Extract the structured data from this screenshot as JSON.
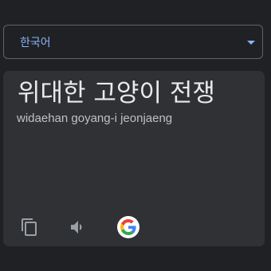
{
  "language_selector": {
    "selected": "한국어"
  },
  "result": {
    "translation": "위대한 고양이 전쟁",
    "romanization": "widaehan goyang-i jeonjaeng"
  },
  "actions": {
    "copy_icon": "copy-icon",
    "speak_icon": "speaker-icon",
    "google_icon": "google-logo-icon"
  },
  "colors": {
    "background": "#202124",
    "card": "#303134",
    "accent": "#8ab4f8",
    "text_primary": "#e8eaed",
    "text_secondary": "#bdc1c6",
    "icon": "#9aa0a6"
  }
}
